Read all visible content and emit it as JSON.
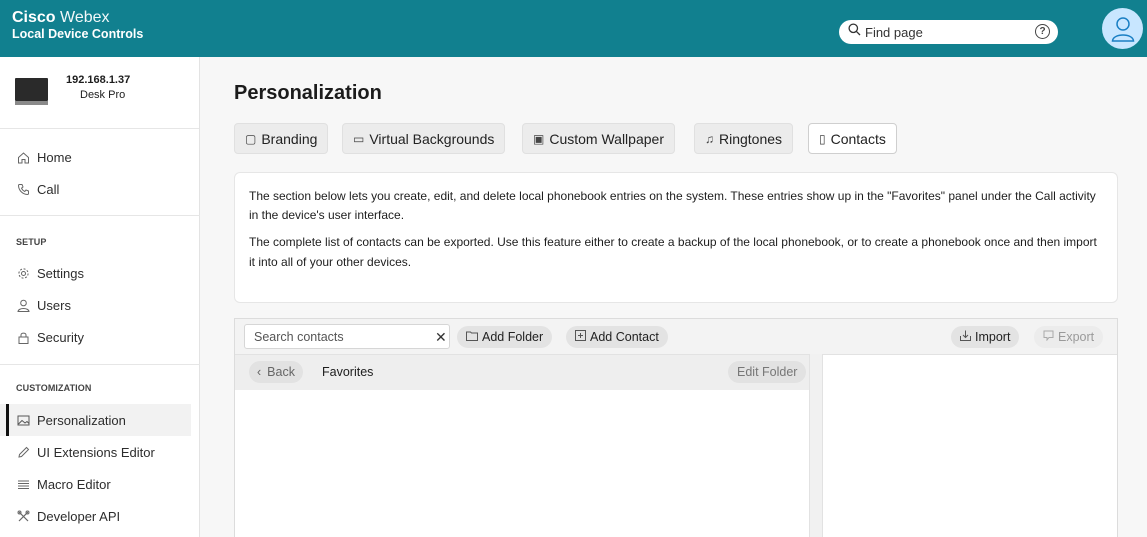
{
  "header": {
    "brand_bold": "Cisco",
    "brand_light": "Webex",
    "subtitle": "Local Device Controls",
    "search_placeholder": "Find page",
    "help_glyph": "?",
    "colors": {
      "bar": "#11808f",
      "avatar": "#c8e6ff"
    }
  },
  "device": {
    "ip": "192.168.1.37",
    "model": "Desk Pro"
  },
  "sidebar": {
    "main_items": [
      {
        "label": "Home",
        "icon": "home-icon"
      },
      {
        "label": "Call",
        "icon": "phone-icon"
      }
    ],
    "setup_label": "SETUP",
    "setup_items": [
      {
        "label": "Settings",
        "icon": "gear-icon"
      },
      {
        "label": "Users",
        "icon": "user-icon"
      },
      {
        "label": "Security",
        "icon": "lock-icon"
      }
    ],
    "custom_label": "CUSTOMIZATION",
    "custom_items": [
      {
        "label": "Personalization",
        "icon": "image-icon",
        "active": true
      },
      {
        "label": "UI Extensions Editor",
        "icon": "pencil-icon"
      },
      {
        "label": "Macro Editor",
        "icon": "lines-icon"
      },
      {
        "label": "Developer API",
        "icon": "tools-icon"
      }
    ]
  },
  "page": {
    "title": "Personalization",
    "tabs": [
      {
        "label": "Branding",
        "icon": "branding-icon"
      },
      {
        "label": "Virtual Backgrounds",
        "icon": "background-icon"
      },
      {
        "label": "Custom Wallpaper",
        "icon": "wallpaper-icon"
      },
      {
        "label": "Ringtones",
        "icon": "music-icon"
      },
      {
        "label": "Contacts",
        "icon": "contacts-icon",
        "active": true
      }
    ],
    "info_p1": "The section below lets you create, edit, and delete local phonebook entries on the system. These entries show up in the \"Favorites\" panel under the Call activity in the device's user interface.",
    "info_p2": "The complete list of contacts can be exported. Use this feature either to create a backup of the local phonebook, or to create a phonebook once and then import it into all of your other devices."
  },
  "contacts": {
    "search_placeholder": "Search contacts",
    "clear_glyph": "✕",
    "add_folder": "Add Folder",
    "add_contact": "Add Contact",
    "import": "Import",
    "export": "Export",
    "back": "Back",
    "folder": "Favorites",
    "edit_folder": "Edit Folder"
  }
}
